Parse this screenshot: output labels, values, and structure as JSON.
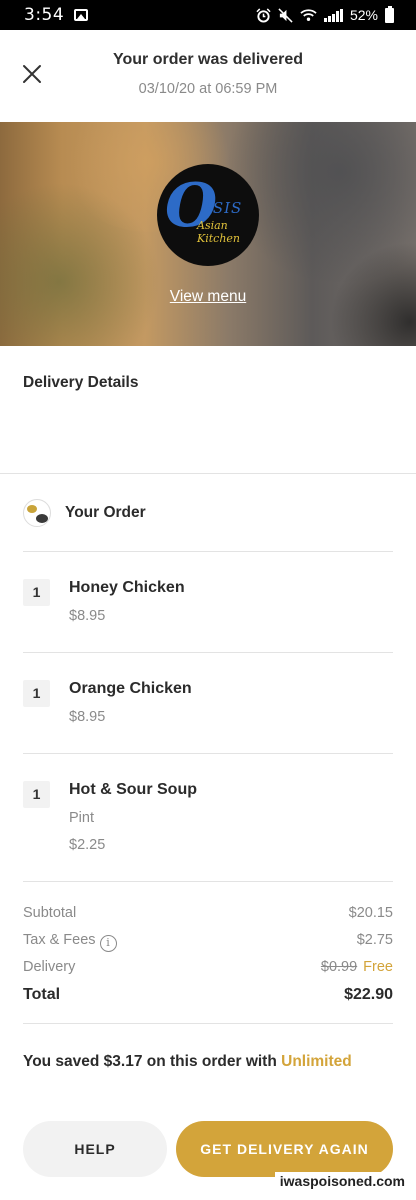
{
  "status_bar": {
    "time": "3:54",
    "battery": "52%"
  },
  "header": {
    "title": "Your order was delivered",
    "datetime": "03/10/20 at 06:59 PM"
  },
  "restaurant": {
    "logo_letter": "O",
    "logo_word": "ASIS",
    "logo_sub": "Asian Kitchen",
    "view_menu": "View menu"
  },
  "delivery": {
    "title": "Delivery Details"
  },
  "order": {
    "title": "Your Order",
    "items": [
      {
        "qty": "1",
        "name": "Honey Chicken",
        "detail": "",
        "price": "$8.95"
      },
      {
        "qty": "1",
        "name": "Orange Chicken",
        "detail": "",
        "price": "$8.95"
      },
      {
        "qty": "1",
        "name": "Hot & Sour Soup",
        "detail": "Pint",
        "price": "$2.25"
      }
    ]
  },
  "totals": {
    "subtotal_label": "Subtotal",
    "subtotal": "$20.15",
    "tax_label": "Tax & Fees",
    "tax": "$2.75",
    "delivery_label": "Delivery",
    "delivery_old": "$0.99",
    "delivery_new": "Free",
    "total_label": "Total",
    "total": "$22.90"
  },
  "savings": {
    "prefix": "You saved $3.17 on this order with ",
    "program": "Unlimited"
  },
  "buttons": {
    "help": "HELP",
    "again": "GET DELIVERY AGAIN"
  },
  "watermark": "iwaspoisoned.com",
  "colors": {
    "accent": "#d3a43a",
    "muted": "#8a8a8a"
  }
}
